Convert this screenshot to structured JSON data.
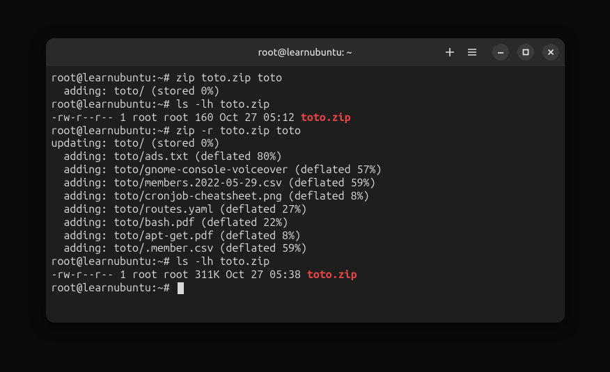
{
  "window": {
    "title": "root@learnubuntu: ~"
  },
  "prompt": "root@learnubuntu:~#",
  "lines": {
    "cmd1": "zip toto.zip toto",
    "out1": "  adding: toto/ (stored 0%)",
    "cmd2": "ls -lh toto.zip",
    "ls1_prefix": "-rw-r--r-- 1 root root 160 Oct 27 05:12 ",
    "ls1_file": "toto.zip",
    "cmd3": "zip -r toto.zip toto",
    "out3_0": "updating: toto/ (stored 0%)",
    "out3_1": "  adding: toto/ads.txt (deflated 80%)",
    "out3_2": "  adding: toto/gnome-console-voiceover (deflated 57%)",
    "out3_3": "  adding: toto/members.2022-05-29.csv (deflated 59%)",
    "out3_4": "  adding: toto/cronjob-cheatsheet.png (deflated 8%)",
    "out3_5": "  adding: toto/routes.yaml (deflated 27%)",
    "out3_6": "  adding: toto/bash.pdf (deflated 22%)",
    "out3_7": "  adding: toto/apt-get.pdf (deflated 8%)",
    "out3_8": "  adding: toto/.member.csv (deflated 59%)",
    "cmd4": "ls -lh toto.zip",
    "ls2_prefix": "-rw-r--r-- 1 root root 311K Oct 27 05:38 ",
    "ls2_file": "toto.zip"
  }
}
